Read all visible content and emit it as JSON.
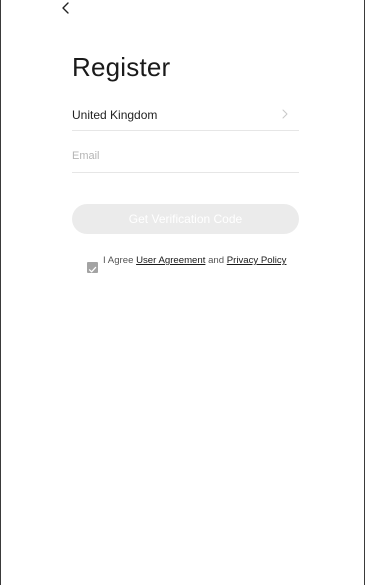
{
  "nav": {
    "back_icon": "chevron-left-icon"
  },
  "title": "Register",
  "country": {
    "label": "United Kingdom",
    "chevron_icon": "chevron-right-icon"
  },
  "email": {
    "value": "",
    "placeholder": "Email"
  },
  "verify_button": {
    "label": "Get Verification Code",
    "enabled": false
  },
  "agreement": {
    "checked": true,
    "prefix": "I Agree ",
    "user_agreement": "User Agreement",
    "and": " and ",
    "privacy_policy": "Privacy Policy"
  }
}
